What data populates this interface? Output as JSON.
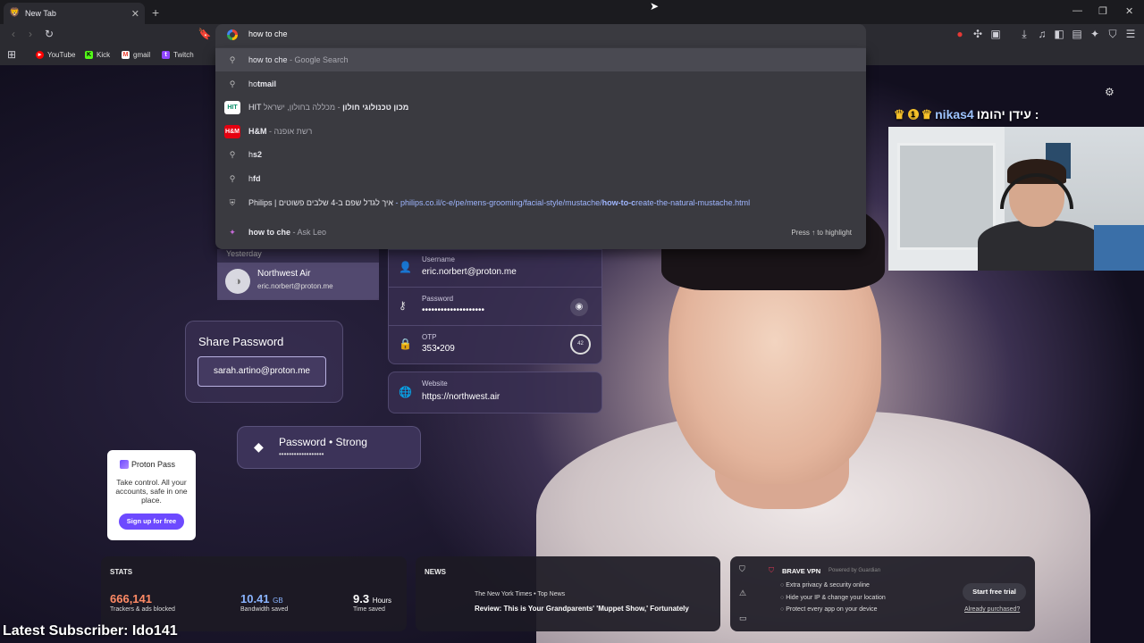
{
  "tab": {
    "title": "New Tab"
  },
  "omnibox": {
    "value": "how to che"
  },
  "bookmarks": [
    {
      "label": "YouTube",
      "color": "#ff0000",
      "glyph": "▶"
    },
    {
      "label": "Kick",
      "color": "#53fc18",
      "glyph": "K"
    },
    {
      "label": "gmail",
      "color": "#ea4335",
      "glyph": "M"
    },
    {
      "label": "Twitch",
      "color": "#9146ff",
      "glyph": "t"
    }
  ],
  "suggestions": {
    "s1_main": "how to che",
    "s1_desc": " - Google Search",
    "s2_pre": "ho",
    "s2_bold": "tmail",
    "s3_pre": "HIT ",
    "s3_bold": "מכון טכנולוגי חולון",
    "s3_desc": " - מכללה בחולון, ישראל",
    "s4_bold": "H&M",
    "s4_desc": " - רשת אופנה",
    "s5_pre": "h",
    "s5_bold": "s2",
    "s6_pre": "h",
    "s6_bold": "fd",
    "s7_title": "Philips | איך לגדל שפם ב-4 שלבים פשוטים",
    "s7_url_pre": " - philips.co.il/c-e/pe/mens-grooming/facial-style/mustache/",
    "s7_url_bold": "how-to-c",
    "s7_url_post": "reate-the-natural-mustache.html",
    "s8_main": "how to che",
    "s8_desc": " - Ask Leo",
    "s8_hint": "Press ↑ to highlight"
  },
  "proton": {
    "history_date": "Yesterday",
    "item_name": "Northwest Air",
    "item_email": "eric.norbert@proton.me",
    "username_label": "Username",
    "username_value": "eric.norbert@proton.me",
    "password_label": "Password",
    "password_value": "••••••••••••••••••••",
    "otp_label": "OTP",
    "otp_value": "353•209",
    "otp_timer": "42",
    "website_label": "Website",
    "website_value": "https://northwest.air",
    "share_title": "Share Password",
    "share_email": "sarah.artino@proton.me",
    "strong_label": "Password • Strong",
    "strong_dots": "••••••••••••••••••"
  },
  "promo": {
    "brand": "Proton Pass",
    "tagline": "Take control. All your accounts, safe in one place.",
    "cta": "Sign up for free"
  },
  "overlay": {
    "name_he": "עידן יהומו :",
    "nick": "nikas4",
    "badge": "1",
    "latest_subscriber": "Latest Subscriber: Ido141"
  },
  "stats": {
    "title": "STATS",
    "trackers_value": "666,141",
    "trackers_label": "Trackers & ads blocked",
    "bandwidth_value": "10.41",
    "bandwidth_unit": "GB",
    "bandwidth_label": "Bandwidth saved",
    "time_value": "9.3",
    "time_unit": "Hours",
    "time_label": "Time saved"
  },
  "news": {
    "title": "NEWS",
    "source": "The New York Times  •  Top News",
    "headline": "Review: This is Your Grandparents' 'Muppet Show,' Fortunately"
  },
  "vpn": {
    "title": "BRAVE VPN",
    "powered": "Powered by  Guardian",
    "line1": "Extra privacy & security online",
    "line2": "Hide your IP & change your location",
    "line3": "Protect every app on your device",
    "cta": "Start free trial",
    "link": "Already purchased?"
  },
  "colors": {
    "trackers": "#ff8a65",
    "bandwidth": "#8ab4ff",
    "accent": "#6d4aff"
  }
}
